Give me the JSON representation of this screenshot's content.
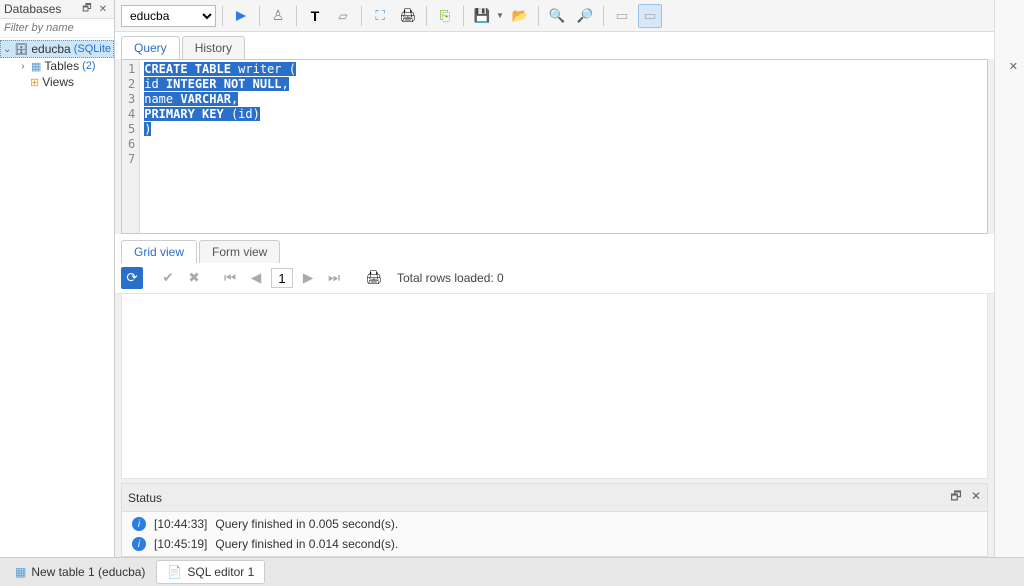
{
  "leftPanel": {
    "title": "Databases",
    "filterPlaceholder": "Filter by name",
    "tree": {
      "dbName": "educba",
      "dbType": "(SQLite",
      "tablesLabel": "Tables",
      "tablesCount": "(2)",
      "viewsLabel": "Views"
    }
  },
  "toolbar": {
    "dbSelected": "educba"
  },
  "sqlTabs": {
    "query": "Query",
    "history": "History"
  },
  "editor": {
    "lines": [
      "1",
      "2",
      "3",
      "4",
      "5",
      "6",
      "7"
    ],
    "code": {
      "l1a": "CREATE TABLE ",
      "l1b": "writer (",
      "l2a": "   id ",
      "l2b": "INTEGER NOT NULL",
      "l2c": ",",
      "l3a": "   name ",
      "l3b": "VARCHAR",
      "l3c": ",",
      "l4a": "   PRIMARY KEY ",
      "l4b": "(id)",
      "l5": ")"
    }
  },
  "resTabs": {
    "grid": "Grid view",
    "form": "Form view"
  },
  "resToolbar": {
    "page": "1",
    "rowsText": "Total rows loaded: 0"
  },
  "status": {
    "title": "Status",
    "rows": [
      {
        "ts": "[10:44:33]",
        "msg": "Query finished in 0.005 second(s)."
      },
      {
        "ts": "[10:45:19]",
        "msg": "Query finished in 0.014 second(s)."
      }
    ]
  },
  "bottomTabs": {
    "t1": "New table 1 (educba)",
    "t2": "SQL editor 1"
  }
}
